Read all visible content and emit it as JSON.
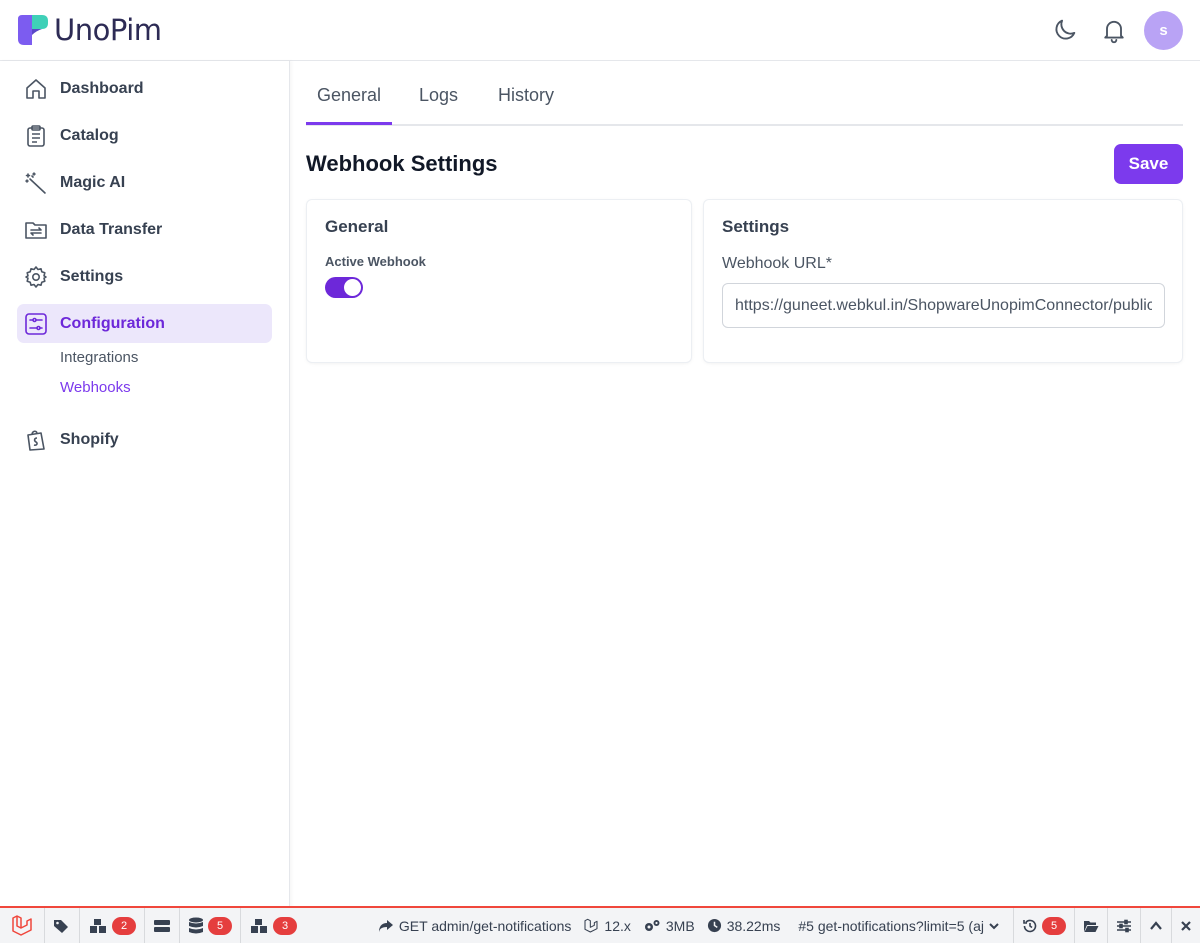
{
  "header": {
    "brand": "UnoPim",
    "avatar_initial": "s",
    "icons": [
      "moon-icon",
      "bell-icon"
    ]
  },
  "sidebar": {
    "items": [
      {
        "label": "Dashboard",
        "icon": "home-icon"
      },
      {
        "label": "Catalog",
        "icon": "clipboard-icon"
      },
      {
        "label": "Magic AI",
        "icon": "magic-wand-icon"
      },
      {
        "label": "Data Transfer",
        "icon": "folder-transfer-icon"
      },
      {
        "label": "Settings",
        "icon": "gear-icon"
      },
      {
        "label": "Configuration",
        "icon": "sliders-icon",
        "active": true
      },
      {
        "label": "Shopify",
        "icon": "shopify-bag-icon"
      }
    ],
    "subitems": [
      {
        "label": "Integrations"
      },
      {
        "label": "Webhooks",
        "active": true
      }
    ]
  },
  "tabs": [
    {
      "label": "General",
      "active": true
    },
    {
      "label": "Logs"
    },
    {
      "label": "History"
    }
  ],
  "page": {
    "title": "Webhook Settings",
    "save_label": "Save"
  },
  "general_card": {
    "title": "General",
    "toggle_label": "Active Webhook",
    "toggle_on": true
  },
  "settings_card": {
    "title": "Settings",
    "url_label": "Webhook URL*",
    "url_value": "https://guneet.webkul.in/ShopwareUnopimConnector/public/"
  },
  "debugbar": {
    "badges": [
      "2",
      "5",
      "3"
    ],
    "request": "GET admin/get-notifications",
    "version": "12.x",
    "memory": "3MB",
    "time": "38.22ms",
    "request_select": "#5 get-notifications?limit=5 (aj",
    "history_count": "5"
  },
  "colors": {
    "accent": "#7c3aed",
    "accent_bg": "#ece7fb",
    "debugbar_border": "#f0473c"
  }
}
